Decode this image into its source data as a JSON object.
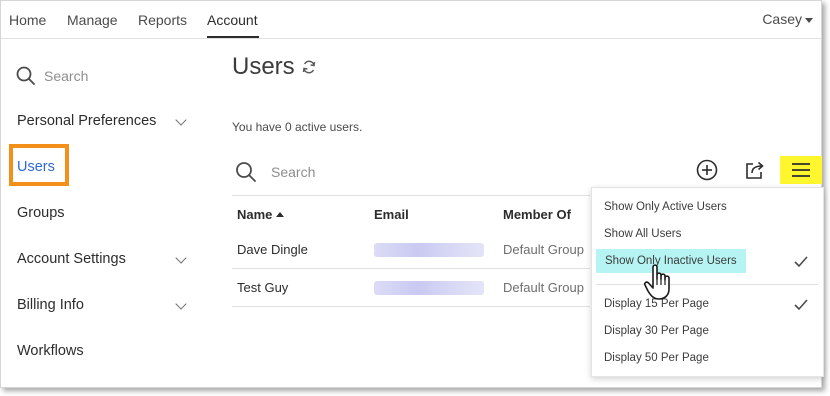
{
  "nav": {
    "items": [
      "Home",
      "Manage",
      "Reports",
      "Account"
    ],
    "active": "Account",
    "user": "Casey"
  },
  "sidebar": {
    "search_placeholder": "Search",
    "items": [
      {
        "label": "Personal Preferences",
        "expandable": true
      },
      {
        "label": "Users",
        "expandable": false,
        "selected": true
      },
      {
        "label": "Groups",
        "expandable": false
      },
      {
        "label": "Account Settings",
        "expandable": true
      },
      {
        "label": "Billing Info",
        "expandable": true
      },
      {
        "label": "Workflows",
        "expandable": false
      }
    ]
  },
  "main": {
    "title": "Users",
    "active_message": "You have 0 active users.",
    "search_placeholder": "Search",
    "columns": [
      "Name",
      "Email",
      "Member Of"
    ],
    "sort_column": "Name",
    "rows": [
      {
        "name": "Dave Dingle",
        "member_of": "Default Group"
      },
      {
        "name": "Test Guy",
        "member_of": "Default Group"
      }
    ]
  },
  "menu": {
    "items": [
      {
        "label": "Show Only Active Users",
        "checked": false,
        "highlighted": false
      },
      {
        "label": "Show All Users",
        "checked": false,
        "highlighted": false
      },
      {
        "label": "Show Only Inactive Users",
        "checked": true,
        "highlighted": true
      },
      {
        "label": "Display 15 Per Page",
        "checked": true,
        "highlighted": false
      },
      {
        "label": "Display 30 Per Page",
        "checked": false,
        "highlighted": false
      },
      {
        "label": "Display 50 Per Page",
        "checked": false,
        "highlighted": false
      }
    ]
  },
  "colors": {
    "accent_blue": "#2d69d6",
    "selection_box": "#f39019",
    "hamburger_highlight": "#fff62e",
    "menu_highlight": "#b6f4f4"
  },
  "icons": [
    "search-icon",
    "refresh-icon",
    "add-circle-icon",
    "share-icon",
    "hamburger-menu-icon",
    "checkmark-icon",
    "hand-cursor-icon",
    "chevron-down-icon"
  ]
}
